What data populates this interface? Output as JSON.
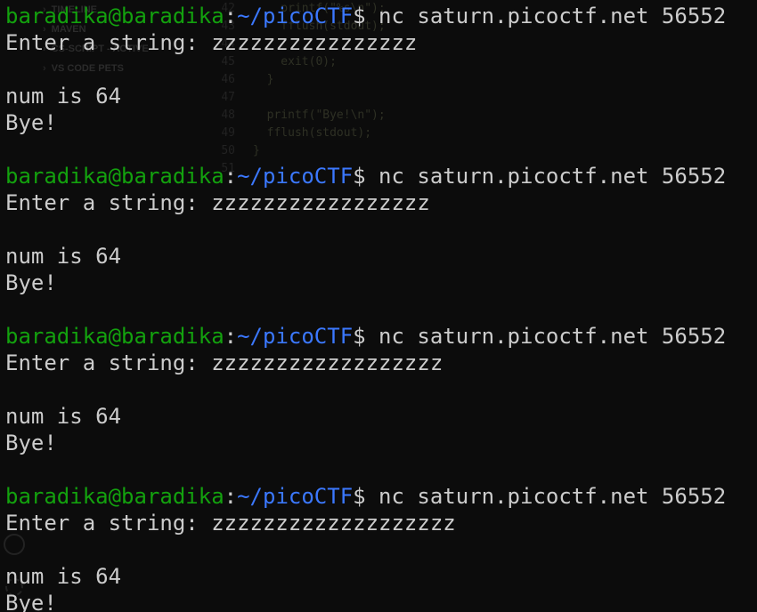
{
  "colors": {
    "background": "#0c0c0c",
    "text": "#cccccc",
    "prompt_user": "#13a10e",
    "prompt_path": "#3b78ff"
  },
  "prompt": {
    "user_host": "baradika@baradika",
    "separator": ":",
    "path": "~/picoCTF",
    "symbol": "$"
  },
  "sessions": [
    {
      "command": "nc saturn.picoctf.net 56552",
      "prompt_text": "Enter a string: ",
      "input": "zzzzzzzzzzzzzzzz",
      "result": "num is 64",
      "farewell": "Bye!"
    },
    {
      "command": "nc saturn.picoctf.net 56552",
      "prompt_text": "Enter a string: ",
      "input": "zzzzzzzzzzzzzzzzz",
      "result": "num is 64",
      "farewell": "Bye!"
    },
    {
      "command": "nc saturn.picoctf.net 56552",
      "prompt_text": "Enter a string: ",
      "input": "zzzzzzzzzzzzzzzzzz",
      "result": "num is 64",
      "farewell": "Bye!"
    },
    {
      "command": "nc saturn.picoctf.net 56552",
      "prompt_text": "Enter a string: ",
      "input": "zzzzzzzzzzzzzzzzzzz",
      "result": "num is 64",
      "farewell": "Bye!"
    }
  ],
  "background_window": {
    "sidebar_items": [
      "TIMELINE",
      "MAVEN",
      "CS-SCRIPT - ACTIVE",
      "VS CODE PETS"
    ],
    "code_lines": [
      {
        "ln": "42",
        "code": "    printf(\"%s\\n\");"
      },
      {
        "ln": "43",
        "code": "    fflush(stdout);"
      },
      {
        "ln": "44",
        "code": ""
      },
      {
        "ln": "45",
        "code": "    exit(0);"
      },
      {
        "ln": "46",
        "code": "  }"
      },
      {
        "ln": "47",
        "code": ""
      },
      {
        "ln": "48",
        "code": "  printf(\"Bye!\\n\");"
      },
      {
        "ln": "49",
        "code": "  fflush(stdout);"
      },
      {
        "ln": "50",
        "code": "}"
      },
      {
        "ln": "51",
        "code": ""
      }
    ]
  }
}
